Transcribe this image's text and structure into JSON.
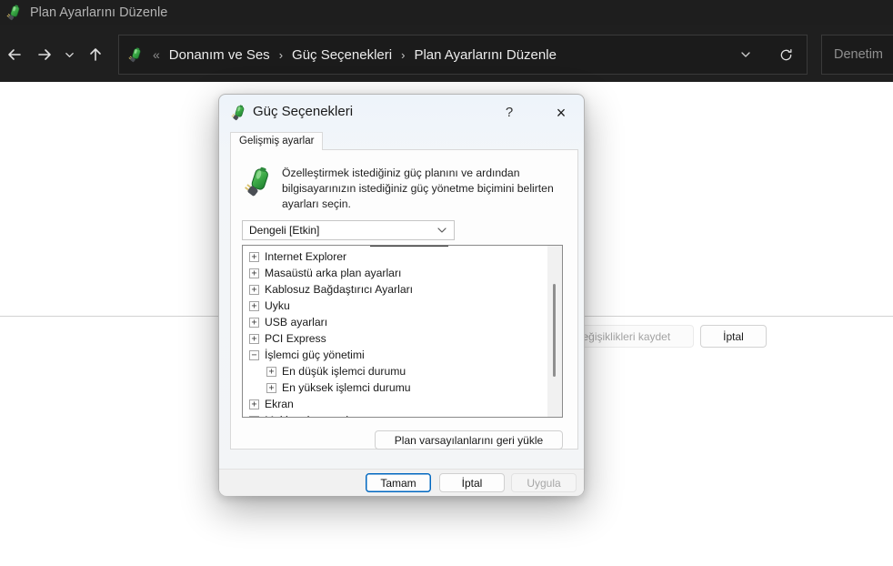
{
  "titlebar": {
    "title": "Plan Ayarlarını Düzenle"
  },
  "navbar": {
    "overflow_glyph": "«",
    "separator": "›",
    "crumbs": [
      "Donanım ve Ses",
      "Güç Seçenekleri",
      "Plan Ayarlarını Düzenle"
    ],
    "search_placeholder": "Denetim"
  },
  "page": {
    "save_changes_button": "Değişiklikleri kaydet",
    "cancel_button": "İptal"
  },
  "dialog": {
    "title": "Güç Seçenekleri",
    "help_glyph": "?",
    "close_glyph": "×",
    "tab_label": "Gelişmiş ayarlar",
    "description_lines": [
      "Özelleştirmek istediğiniz güç planını ve ardından",
      "bilgisayarınızın istediğiniz güç yönetme biçimini belirten",
      "ayarları seçin."
    ],
    "plan_dropdown_value": "Dengeli [Etkin]",
    "tree_items": [
      {
        "label": "Internet Explorer",
        "level": 0,
        "expanded": false
      },
      {
        "label": "Masaüstü arka plan ayarları",
        "level": 0,
        "expanded": false
      },
      {
        "label": "Kablosuz Bağdaştırıcı Ayarları",
        "level": 0,
        "expanded": false
      },
      {
        "label": "Uyku",
        "level": 0,
        "expanded": false
      },
      {
        "label": "USB ayarları",
        "level": 0,
        "expanded": false
      },
      {
        "label": "PCI Express",
        "level": 0,
        "expanded": false
      },
      {
        "label": "İşlemci güç yönetimi",
        "level": 0,
        "expanded": true
      },
      {
        "label": "En düşük işlemci durumu",
        "level": 1,
        "expanded": false
      },
      {
        "label": "En yüksek işlemci durumu",
        "level": 1,
        "expanded": false
      },
      {
        "label": "Ekran",
        "level": 0,
        "expanded": false
      },
      {
        "label": "Multimedya ayarları",
        "level": 0,
        "expanded": false
      }
    ],
    "restore_button": "Plan varsayılanlarını geri yükle",
    "ok_button": "Tamam",
    "cancel_button": "İptal",
    "apply_button": "Uygula"
  },
  "colors": {
    "accent_blue": "#0067c0",
    "titlebar_bg": "#1e1e1e",
    "battery_green": "#3aa845",
    "dialog_bg": "#f3f5f7"
  }
}
